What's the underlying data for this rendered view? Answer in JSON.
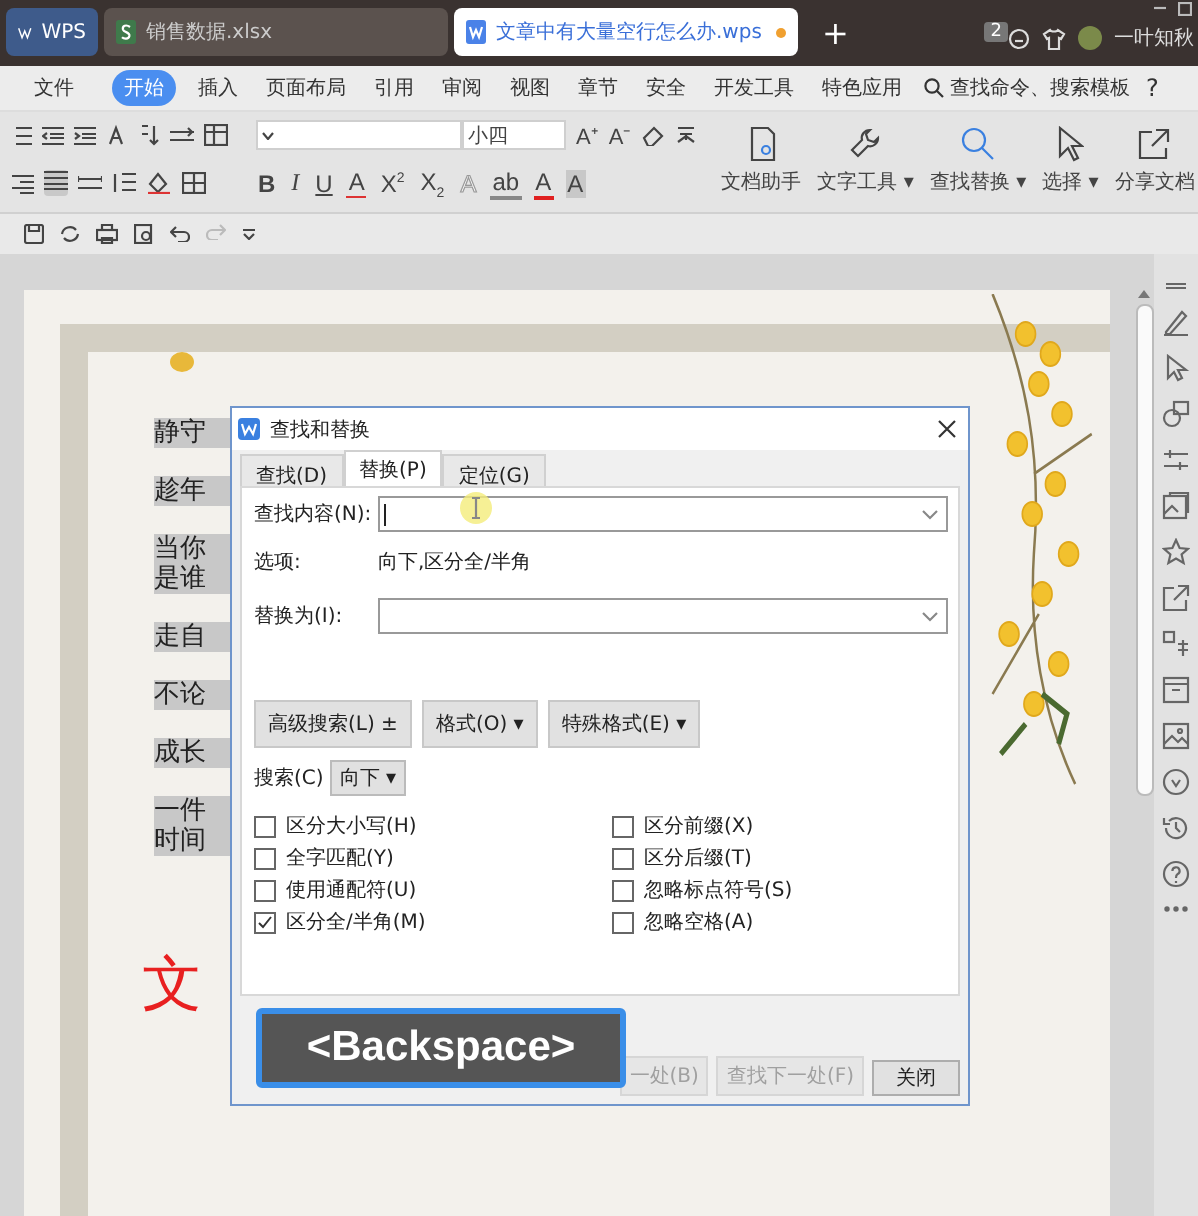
{
  "tabs": [
    {
      "kind": "brand",
      "label": "WPS",
      "selected": false
    },
    {
      "kind": "sheet",
      "label": "销售数据.xlsx",
      "selected": false
    },
    {
      "kind": "doc",
      "label": "文章中有大量空行怎么办.wps",
      "selected": true,
      "modified": true
    }
  ],
  "new_tab": "+",
  "tab_count": "2",
  "user_name": "一叶知秋",
  "menu": {
    "file": "文件",
    "items": [
      {
        "label": "开始",
        "selected": true
      },
      {
        "label": "插入",
        "selected": false
      },
      {
        "label": "页面布局",
        "selected": false
      },
      {
        "label": "引用",
        "selected": false
      },
      {
        "label": "审阅",
        "selected": false
      },
      {
        "label": "视图",
        "selected": false
      },
      {
        "label": "章节",
        "selected": false
      },
      {
        "label": "安全",
        "selected": false
      },
      {
        "label": "开发工具",
        "selected": false
      },
      {
        "label": "特色应用",
        "selected": false
      }
    ],
    "search": "查找命令、搜索模板",
    "help": "?"
  },
  "ribbon": {
    "font_size": "小四",
    "font_tools": [
      "A⁺",
      "A⁻"
    ],
    "format_buttons": [
      {
        "kind": "bold",
        "label": "B"
      },
      {
        "kind": "italic",
        "label": "I"
      },
      {
        "kind": "underline",
        "label": "U"
      },
      {
        "kind": "strike",
        "label": "A"
      },
      {
        "kind": "plain",
        "label": "X$^{2}$"
      },
      {
        "kind": "plain",
        "label": "X$_{2}$"
      },
      {
        "kind": "outline",
        "label": "A"
      },
      {
        "kind": "highlight",
        "label": "ab"
      },
      {
        "kind": "color",
        "label": "A"
      },
      {
        "kind": "shade",
        "label": "A"
      }
    ],
    "big_buttons": [
      {
        "kind": "assistant",
        "label": "文档助手",
        "dropdown": false
      },
      {
        "kind": "tools",
        "label": "文字工具",
        "dropdown": true,
        "caret": "▾"
      },
      {
        "kind": "find",
        "label": "查找替换",
        "dropdown": true,
        "caret": "▾"
      },
      {
        "kind": "select",
        "label": "选择",
        "dropdown": true,
        "caret": "▾"
      },
      {
        "kind": "share",
        "label": "分享文档",
        "dropdown": false
      }
    ]
  },
  "document": {
    "paragraphs": [
      {
        "lines": [
          "静守"
        ]
      },
      {
        "lines": [
          "趁年"
        ]
      },
      {
        "lines": [
          "当你",
          "是谁"
        ]
      },
      {
        "lines": [
          "走自"
        ]
      },
      {
        "lines": [
          "不论"
        ]
      },
      {
        "lines": [
          "成长"
        ]
      },
      {
        "lines": [
          "一件",
          "时间"
        ]
      }
    ],
    "heading_fragment": "文"
  },
  "dialog": {
    "title": "查找和替换",
    "tabs": [
      {
        "label": "查找(D)",
        "selected": false
      },
      {
        "label": "替换(P)",
        "selected": true
      },
      {
        "label": "定位(G)",
        "selected": false
      }
    ],
    "find_label": "查找内容(N):",
    "options_label": "选项:",
    "options_value": "向下,区分全/半角",
    "replace_label": "替换为(I):",
    "buttons": [
      {
        "label": "高级搜索(L)",
        "caret": "±"
      },
      {
        "label": "格式(O)",
        "caret": "▾"
      },
      {
        "label": "特殊格式(E)",
        "caret": "▾"
      }
    ],
    "search_label": "搜索(C)",
    "search_direction": "向下",
    "search_caret": "▾",
    "checkboxes": [
      {
        "label": "区分大小写(H)",
        "checked": false
      },
      {
        "label": "全字匹配(Y)",
        "checked": false
      },
      {
        "label": "使用通配符(U)",
        "checked": false
      },
      {
        "label": "区分全/半角(M)",
        "checked": true
      },
      {
        "label": "区分前缀(X)",
        "checked": false
      },
      {
        "label": "区分后缀(T)",
        "checked": false
      },
      {
        "label": "忽略标点符号(S)",
        "checked": false
      },
      {
        "label": "忽略空格(A)",
        "checked": false
      }
    ],
    "actions": [
      {
        "label": "一处(B)",
        "disabled": true
      },
      {
        "label": "查找下一处(F)",
        "disabled": true
      },
      {
        "label": "关闭",
        "disabled": false
      }
    ]
  },
  "key_overlay": "<Backspace>"
}
